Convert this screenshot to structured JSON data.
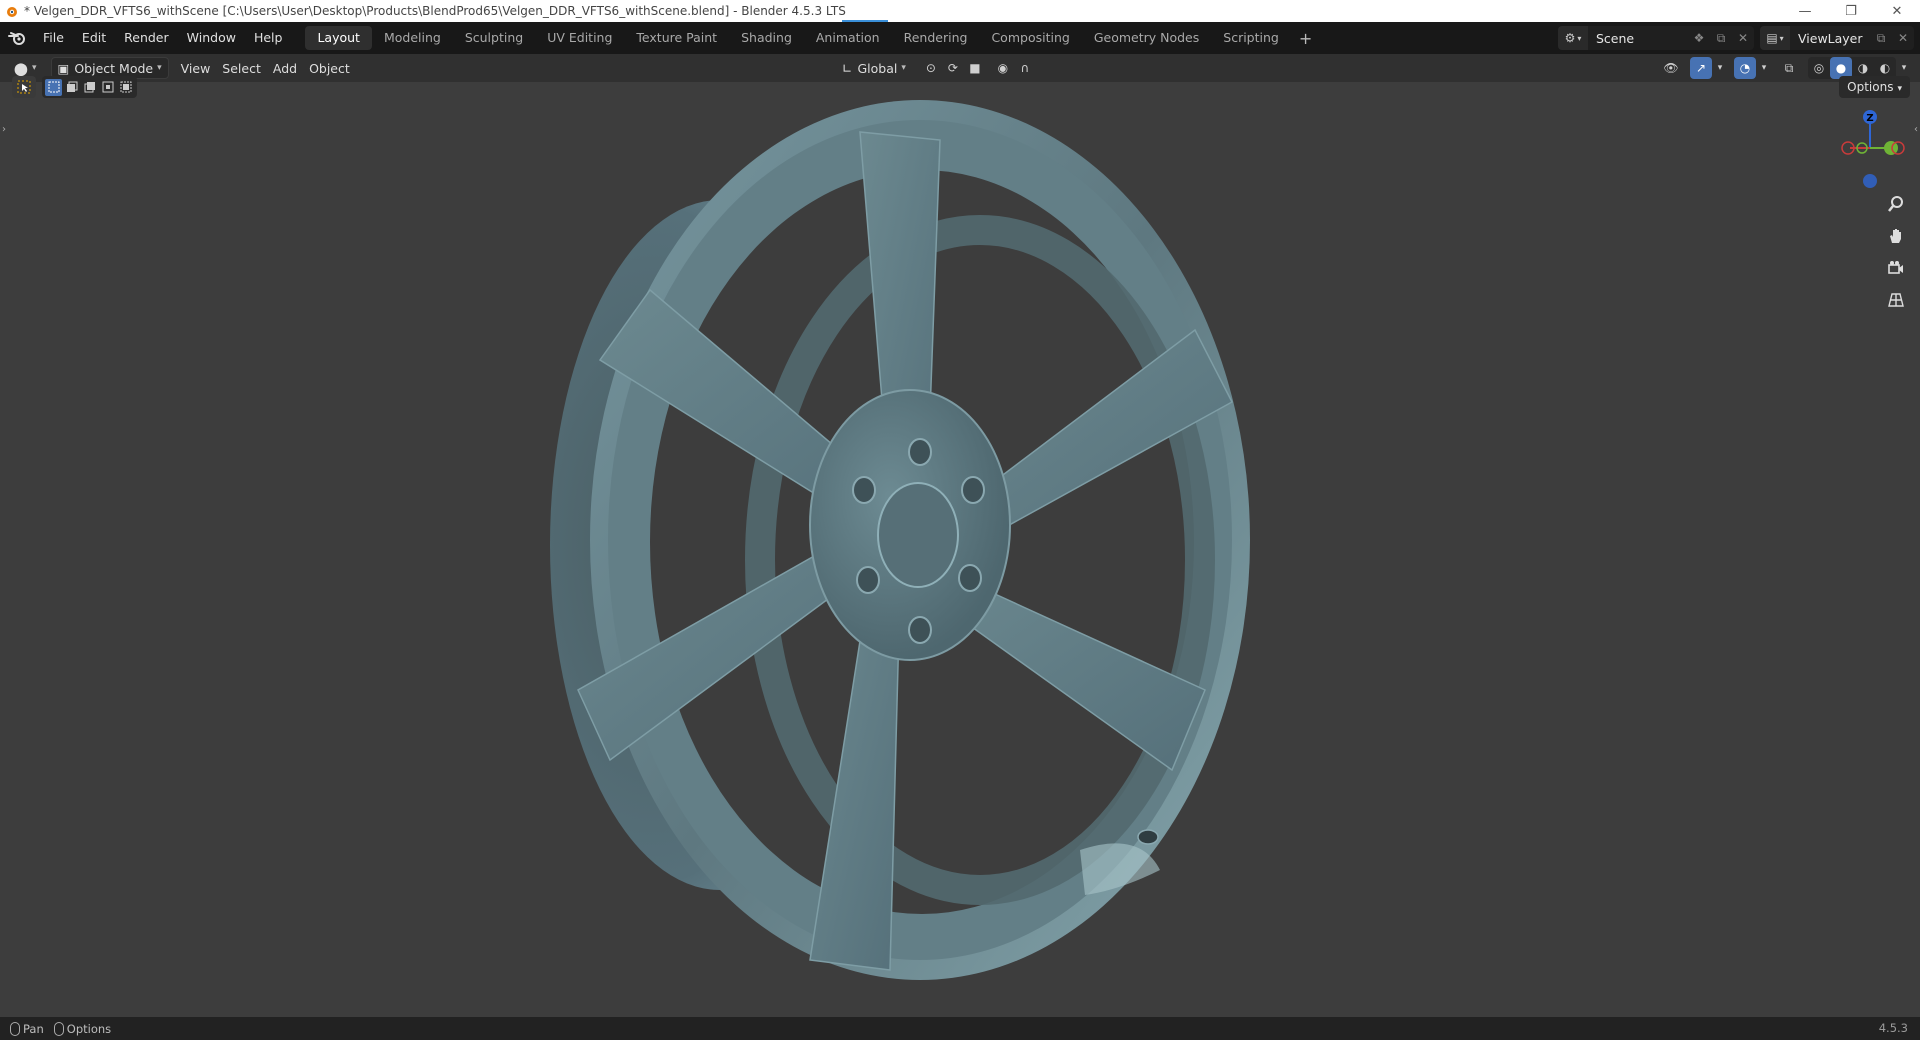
{
  "window": {
    "title": "* Velgen_DDR_VFTS6_withScene [C:\\Users\\User\\Desktop\\Products\\BlendProd65\\Velgen_DDR_VFTS6_withScene.blend] - Blender 4.5.3 LTS",
    "controls": [
      "minimize-icon",
      "restore-icon",
      "close-icon"
    ]
  },
  "menu": {
    "items": [
      "File",
      "Edit",
      "Render",
      "Window",
      "Help"
    ]
  },
  "workspaces": {
    "tabs": [
      "Layout",
      "Modeling",
      "Sculpting",
      "UV Editing",
      "Texture Paint",
      "Shading",
      "Animation",
      "Rendering",
      "Compositing",
      "Geometry Nodes",
      "Scripting"
    ],
    "active": "Layout",
    "add_label": "+"
  },
  "scene": {
    "name": "Scene"
  },
  "view_layer": {
    "name": "ViewLayer"
  },
  "header": {
    "mode": "Object Mode",
    "view": "View",
    "select": "Select",
    "add": "Add",
    "object": "Object",
    "orientation": "Global"
  },
  "viewport": {
    "options_label": "Options",
    "gizmo_axes": [
      "Z",
      "X",
      "Y"
    ],
    "accent_color": "#4772b3",
    "wheel_color": "#5b7278"
  },
  "statusbar": {
    "pan": "Pan",
    "options": "Options",
    "version": "4.5.3"
  }
}
